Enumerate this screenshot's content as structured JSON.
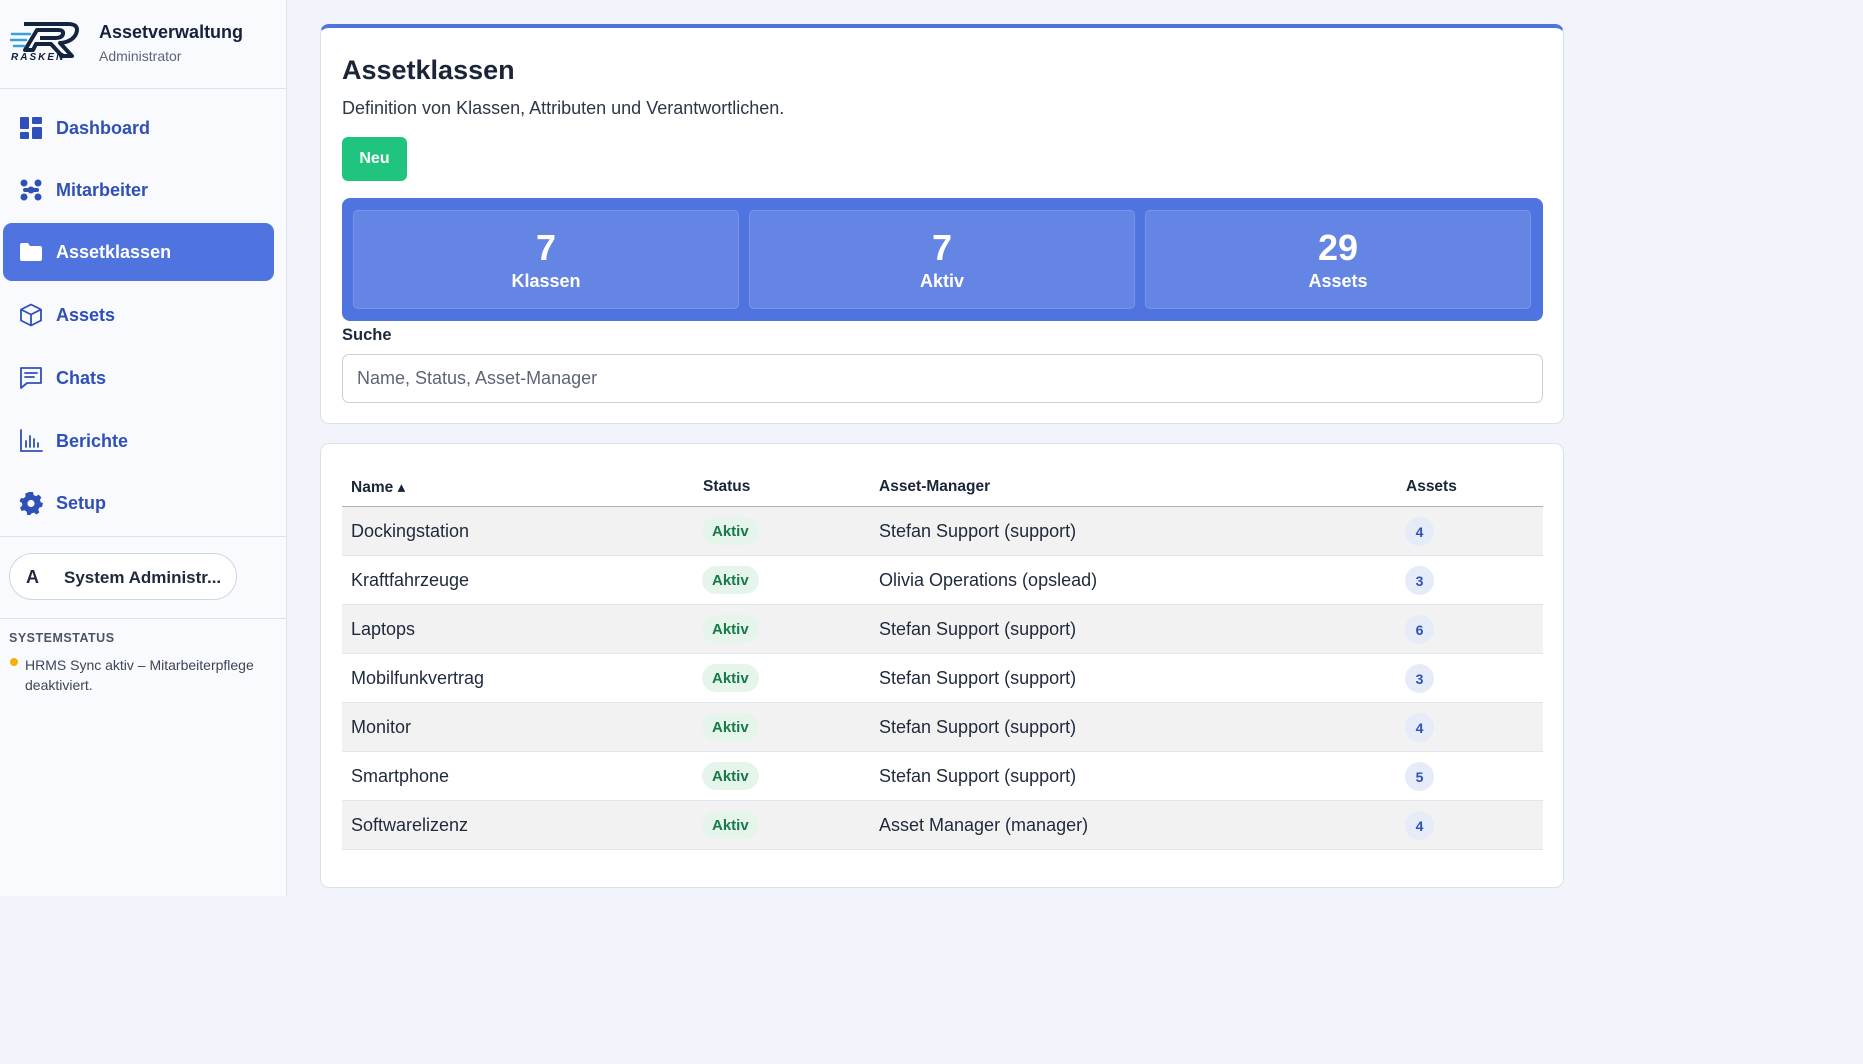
{
  "app": {
    "logo_text": "RASKEN",
    "title": "Assetverwaltung",
    "role": "Administrator"
  },
  "sidebar": {
    "items": [
      {
        "label": "Dashboard",
        "icon": "dashboard-icon",
        "active": false
      },
      {
        "label": "Mitarbeiter",
        "icon": "people-icon",
        "active": false
      },
      {
        "label": "Assetklassen",
        "icon": "folder-icon",
        "active": true
      },
      {
        "label": "Assets",
        "icon": "cube-icon",
        "active": false
      },
      {
        "label": "Chats",
        "icon": "chat-icon",
        "active": false
      },
      {
        "label": "Berichte",
        "icon": "bar-chart-icon",
        "active": false
      },
      {
        "label": "Setup",
        "icon": "gear-icon",
        "active": false
      }
    ],
    "user": {
      "initial": "A",
      "name": "System Administr..."
    },
    "system_status": {
      "title": "SYSTEMSTATUS",
      "text": "HRMS Sync aktiv – Mitarbeiterpflege deaktiviert."
    }
  },
  "main": {
    "title": "Assetklassen",
    "subtitle": "Definition von Klassen, Attributen und Verantwortlichen.",
    "new_button": "Neu",
    "stats": [
      {
        "value": "7",
        "label": "Klassen"
      },
      {
        "value": "7",
        "label": "Aktiv"
      },
      {
        "value": "29",
        "label": "Assets"
      }
    ],
    "search": {
      "label": "Suche",
      "placeholder": "Name, Status, Asset-Manager"
    }
  },
  "table": {
    "columns": [
      "Name ▴",
      "Status",
      "Asset-Manager",
      "Assets"
    ],
    "rows": [
      {
        "name": "Dockingstation",
        "status": "Aktiv",
        "manager": "Stefan Support (support)",
        "assets": "4"
      },
      {
        "name": "Kraftfahrzeuge",
        "status": "Aktiv",
        "manager": "Olivia Operations (opslead)",
        "assets": "3"
      },
      {
        "name": "Laptops",
        "status": "Aktiv",
        "manager": "Stefan Support (support)",
        "assets": "6"
      },
      {
        "name": "Mobilfunkvertrag",
        "status": "Aktiv",
        "manager": "Stefan Support (support)",
        "assets": "3"
      },
      {
        "name": "Monitor",
        "status": "Aktiv",
        "manager": "Stefan Support (support)",
        "assets": "4"
      },
      {
        "name": "Smartphone",
        "status": "Aktiv",
        "manager": "Stefan Support (support)",
        "assets": "5"
      },
      {
        "name": "Softwarelizenz",
        "status": "Aktiv",
        "manager": "Asset Manager (manager)",
        "assets": "4"
      }
    ]
  },
  "colors": {
    "accent": "#4f73df",
    "nav_text": "#2f50b6",
    "success": "#1fc57f",
    "status_dot": "#f1b00a"
  }
}
